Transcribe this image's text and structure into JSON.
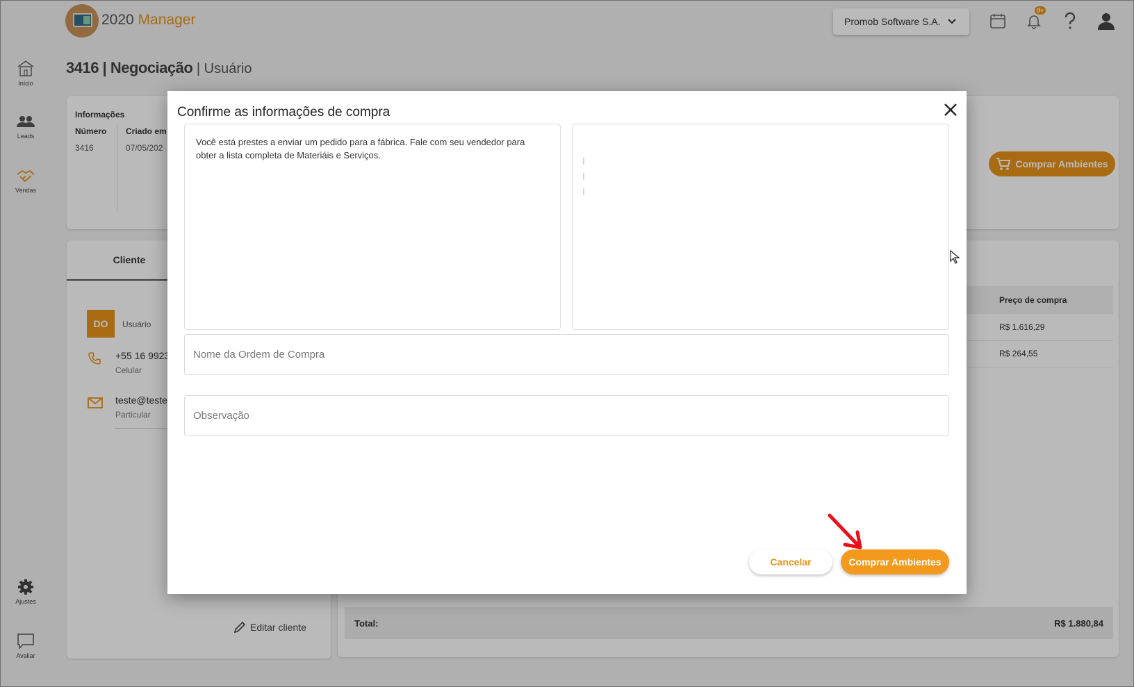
{
  "app": {
    "brand_part1": "2020",
    "brand_part2": " Manager",
    "company": "Promob Software S.A.",
    "notification_badge": "9+"
  },
  "sidebar": {
    "items": [
      {
        "label": "Início"
      },
      {
        "label": "Leads"
      },
      {
        "label": "Vendas"
      },
      {
        "label": "Ajustes"
      },
      {
        "label": "Avaliar"
      }
    ]
  },
  "page": {
    "title_main": "3416 | Negociação",
    "title_sub": " | Usuário"
  },
  "info": {
    "heading": "Informações",
    "numero_label": "Número",
    "numero_value": "3416",
    "criado_label": "Criado em",
    "criado_value": "07/05/202",
    "buy_button": "Comprar Ambientes"
  },
  "client": {
    "tab_label": "Cliente",
    "avatar_initials": "DO",
    "user_label": "Usuário",
    "phone": "+55 16 9923",
    "phone_label": "Celular",
    "email": "teste@teste",
    "email_label": "Particular",
    "edit_button": "Editar cliente"
  },
  "table": {
    "header_price": "Preço de compra",
    "rows": [
      "R$ 1.616,29",
      "R$ 264,55"
    ],
    "total_label": "Total:",
    "total_value": "R$ 1.880,84"
  },
  "modal": {
    "title": "Confirme as informações de compra",
    "message": "Você está prestes a enviar um pedido para a fábrica. Fale com seu vendedor para obter a lista completa de Materiáis e Serviços.",
    "order_name_placeholder": "Nome da Ordem de Compra",
    "observation_placeholder": "Observação",
    "cancel_label": "Cancelar",
    "confirm_label": "Comprar Ambientes"
  },
  "colors": {
    "accent": "#e8931a",
    "annotation_arrow": "#e8101a"
  }
}
